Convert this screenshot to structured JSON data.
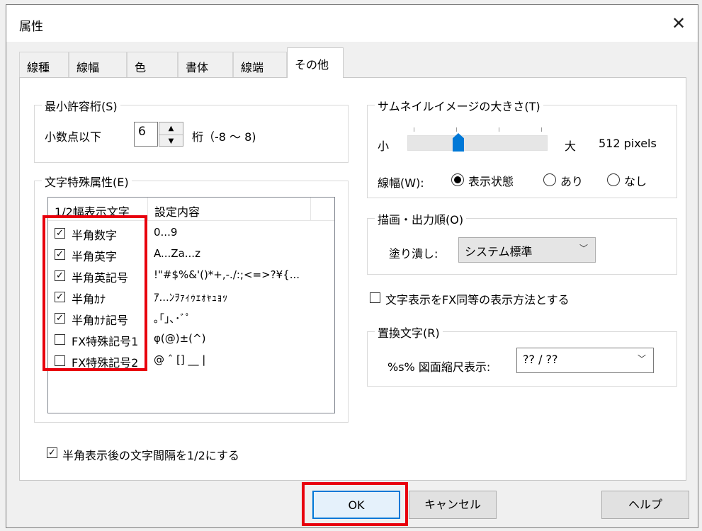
{
  "window": {
    "title": "属性",
    "close_glyph": "✕"
  },
  "tabs": [
    {
      "label": "線種"
    },
    {
      "label": "線幅"
    },
    {
      "label": "色"
    },
    {
      "label": "書体"
    },
    {
      "label": "線端"
    },
    {
      "label": "その他",
      "active": true
    }
  ],
  "min_digits": {
    "title": "最小許容桁(S)",
    "label": "小数点以下",
    "value": "6",
    "unit_label": "桁（-8 ～ 8)",
    "up_glyph": "▲",
    "down_glyph": "▼"
  },
  "char_attr": {
    "title": "文字特殊属性(E)",
    "columns": [
      "1/2幅表示文字",
      "設定内容"
    ],
    "rows": [
      {
        "label": "半角数字",
        "value": "0...9",
        "checked": true
      },
      {
        "label": "半角英字",
        "value": "A...Za...z",
        "checked": true
      },
      {
        "label": "半角英記号",
        "value": " !\"#$%&'()*+,-./:;<=>?¥{...",
        "checked": true
      },
      {
        "label": "半角ｶﾅ",
        "value": "ｱ...ﾝｦｧｨｩｪｫｬｭｮｯ",
        "checked": true
      },
      {
        "label": "半角ｶﾅ記号",
        "value": "｡｢｣､･ﾞﾟ",
        "checked": true
      },
      {
        "label": "FX特殊記号1",
        "value": "φ(@)±(^)",
        "checked": false
      },
      {
        "label": "FX特殊記号2",
        "value": "@  ˆ  [] __ |",
        "checked": false
      }
    ],
    "check_glyph": "✓"
  },
  "half_spacing": {
    "label": "半角表示後の文字間隔を1/2にする",
    "checked": true
  },
  "thumbnail": {
    "title": "サムネイルイメージの大きさ(T)",
    "small_label": "小",
    "large_label": "大",
    "value_text": "512 pixels",
    "slider_fraction": 0.35,
    "line_width_label": "線幅(W):",
    "options": [
      {
        "label": "表示状態",
        "selected": true
      },
      {
        "label": "あり",
        "selected": false
      },
      {
        "label": "なし",
        "selected": false
      }
    ]
  },
  "draw_order": {
    "title": "描画・出力順(O)",
    "fill_label": "塗り潰し:",
    "fill_value": "システム標準",
    "arrow_glyph": "﹀"
  },
  "fx_display": {
    "label": "文字表示をFX同等の表示方法とする",
    "checked": false
  },
  "replace": {
    "title": "置換文字(R)",
    "label": "%s% 図面縮尺表示:",
    "value": "?? / ??"
  },
  "buttons": {
    "ok": "OK",
    "cancel": "キャンセル",
    "help": "ヘルプ"
  },
  "colors": {
    "highlight": "#e8000d",
    "accent": "#0078d7"
  }
}
